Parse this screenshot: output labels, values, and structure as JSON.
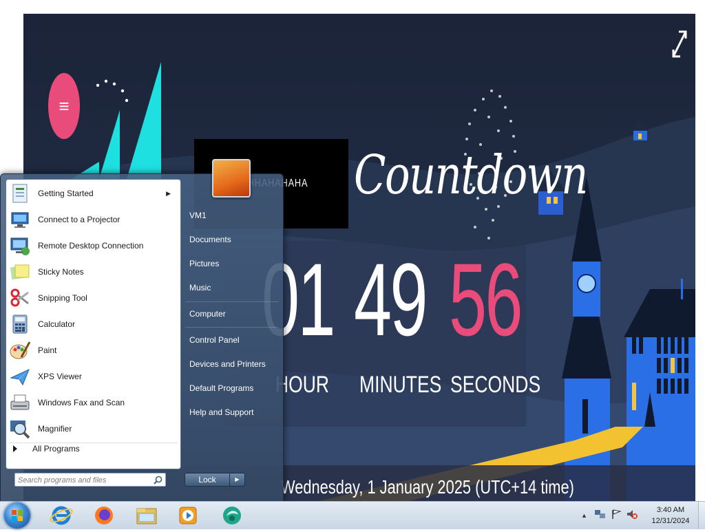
{
  "countdown": {
    "title_text": "HAHHAHAHAHA",
    "heading": "Countdown",
    "hours_value": "01",
    "minutes_value": "49",
    "seconds_value": "56",
    "hours_label": "HOUR",
    "minutes_label": "MINUTES",
    "seconds_label": "SECONDS",
    "target_date": "Wednesday, 1 January 2025 (UTC+14 time)",
    "seconds_color": "#e94b7a"
  },
  "start_menu": {
    "programs": [
      {
        "label": "Getting Started",
        "icon": "getting-started-icon",
        "has_submenu": true
      },
      {
        "label": "Connect to a Projector",
        "icon": "projector-icon"
      },
      {
        "label": "Remote Desktop Connection",
        "icon": "remote-desktop-icon"
      },
      {
        "label": "Sticky Notes",
        "icon": "sticky-notes-icon"
      },
      {
        "label": "Snipping Tool",
        "icon": "snipping-tool-icon"
      },
      {
        "label": "Calculator",
        "icon": "calculator-icon"
      },
      {
        "label": "Paint",
        "icon": "paint-icon"
      },
      {
        "label": "XPS Viewer",
        "icon": "xps-viewer-icon"
      },
      {
        "label": "Windows Fax and Scan",
        "icon": "fax-scan-icon"
      },
      {
        "label": "Magnifier",
        "icon": "magnifier-icon"
      }
    ],
    "all_programs": "All Programs",
    "search_placeholder": "Search programs and files",
    "right_links": [
      {
        "label": "VM1"
      },
      {
        "label": "Documents"
      },
      {
        "label": "Pictures"
      },
      {
        "label": "Music"
      },
      {
        "label": "Computer"
      },
      {
        "label": "Control Panel"
      },
      {
        "label": "Devices and Printers"
      },
      {
        "label": "Default Programs"
      },
      {
        "label": "Help and Support"
      }
    ],
    "lock_label": "Lock"
  },
  "taskbar": {
    "pinned": [
      "internet-explorer-icon",
      "firefox-icon",
      "file-explorer-icon",
      "media-player-icon",
      "app-icon"
    ],
    "clock_time": "3:40 AM",
    "clock_date": "12/31/2024"
  }
}
